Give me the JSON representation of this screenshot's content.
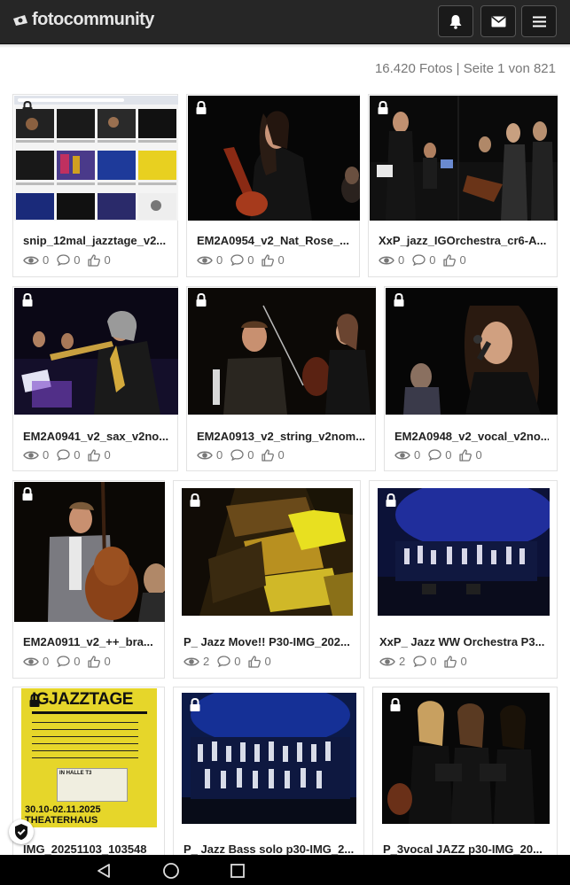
{
  "header": {
    "logo_text": "fotocommunity",
    "icons": [
      "bell-icon",
      "envelope-icon",
      "hamburger-menu-icon"
    ]
  },
  "gallery": {
    "count_text": "16.420 Fotos | Seite 1 von 821",
    "items": [
      {
        "title": "snip_12mal_jazztage_v2...",
        "views": "0",
        "comments": "0",
        "likes": "0"
      },
      {
        "title": "EM2A0954_v2_Nat_Rose_...",
        "views": "0",
        "comments": "0",
        "likes": "0"
      },
      {
        "title": "XxP_jazz_IGOrchestra_cr6-A...",
        "views": "0",
        "comments": "0",
        "likes": "0"
      },
      {
        "title": "EM2A0941_v2_sax_v2no...",
        "views": "0",
        "comments": "0",
        "likes": "0"
      },
      {
        "title": "EM2A0913_v2_string_v2nom...",
        "views": "0",
        "comments": "0",
        "likes": "0"
      },
      {
        "title": "EM2A0948_v2_vocal_v2no...",
        "views": "0",
        "comments": "0",
        "likes": "0"
      },
      {
        "title": "EM2A0911_v2_++_bra...",
        "views": "0",
        "comments": "0",
        "likes": "0"
      },
      {
        "title": "P_ Jazz Move!! P30-IMG_202...",
        "views": "2",
        "comments": "0",
        "likes": "0"
      },
      {
        "title": "XxP_ Jazz WW Orchestra P3...",
        "views": "2",
        "comments": "0",
        "likes": "0"
      },
      {
        "title": "IMG_20251103_103548",
        "views": "",
        "comments": "",
        "likes": ""
      },
      {
        "title": "P_ Jazz Bass solo p30-IMG_2...",
        "views": "",
        "comments": "",
        "likes": ""
      },
      {
        "title": "P_3vocal JAZZ p30-IMG_20...",
        "views": "",
        "comments": "",
        "likes": ""
      }
    ]
  },
  "poster": {
    "line1": "IGJAZZTAGE",
    "dates": "30.10-02.11.2025",
    "venue": "THEATERHAUS",
    "hall": "IN HALLE T3"
  },
  "system_nav": {
    "icons": [
      "back-triangle-icon",
      "home-circle-icon",
      "recents-square-icon"
    ]
  }
}
